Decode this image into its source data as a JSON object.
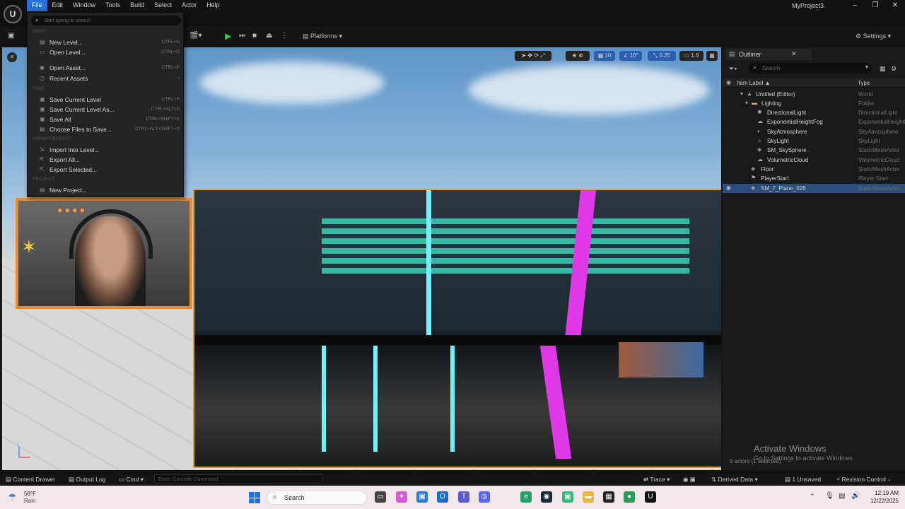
{
  "menubar": {
    "items": [
      "File",
      "Edit",
      "Window",
      "Tools",
      "Build",
      "Select",
      "Actor",
      "Help"
    ]
  },
  "window": {
    "project_name": "MyProject3"
  },
  "toolbar": {
    "platforms_label": "Platforms",
    "settings_label": "Settings"
  },
  "file_menu": {
    "search_placeholder": "Start typing to search",
    "sections": {
      "open": "OPEN",
      "save": "SAVE",
      "import_export": "IMPORT/EXPORT",
      "project": "PROJECT"
    },
    "items": [
      {
        "label": "New Level...",
        "shortcut": "CTRL+N"
      },
      {
        "label": "Open Level...",
        "shortcut": "CTRL+O"
      },
      {
        "label": "Open Asset...",
        "shortcut": "CTRL+P"
      },
      {
        "label": "Recent Assets",
        "shortcut": "›"
      },
      {
        "label": "Save Current Level",
        "shortcut": "CTRL+S"
      },
      {
        "label": "Save Current Level As...",
        "shortcut": "CTRL+ALT+S"
      },
      {
        "label": "Save All",
        "shortcut": "CTRL+SHIFT+S"
      },
      {
        "label": "Choose Files to Save...",
        "shortcut": "CTRL+ALT+SHIFT+S"
      },
      {
        "label": "Import Into Level...",
        "shortcut": ""
      },
      {
        "label": "Export All...",
        "shortcut": ""
      },
      {
        "label": "Export Selected...",
        "shortcut": ""
      },
      {
        "label": "New Project...",
        "shortcut": ""
      }
    ]
  },
  "viewport": {
    "tools": {
      "grid_snap": "10",
      "rotation_snap": "10°",
      "scale_snap": "0.25",
      "camera_speed": "1.6"
    },
    "watermark_title": "Activate Windows",
    "watermark_sub": "Go to Settings to activate Windows."
  },
  "outliner": {
    "title": "Outliner",
    "search_placeholder": "Search",
    "col_label": "Item Label ▲",
    "col_type": "Type",
    "rows": [
      {
        "name": "Untitled (Editor)",
        "type": "World"
      },
      {
        "name": "Lighting",
        "type": "Folder"
      },
      {
        "name": "DirectionalLight",
        "type": "DirectionalLight"
      },
      {
        "name": "ExponentialHeightFog",
        "type": "ExponentialHeightFog"
      },
      {
        "name": "SkyAtmosphere",
        "type": "SkyAtmosphere"
      },
      {
        "name": "SkyLight",
        "type": "SkyLight"
      },
      {
        "name": "SM_SkySphere",
        "type": "StaticMeshActor"
      },
      {
        "name": "VolumetricCloud",
        "type": "VolumetricCloud"
      },
      {
        "name": "Floor",
        "type": "StaticMeshActor"
      },
      {
        "name": "PlayerStart",
        "type": "Player Start"
      },
      {
        "name": "SM_7_Plane_028",
        "type": "StaticMeshActor"
      }
    ],
    "actor_count": "9 actors (1 selected)"
  },
  "statusbar": {
    "content_drawer": "Content Drawer",
    "output_log": "Output Log",
    "cmd": "Cmd",
    "console_placeholder": "Enter Console Command",
    "trace": "Trace",
    "derived_data": "Derived Data",
    "unsaved": "1 Unsaved",
    "revision_control": "Revision Control"
  },
  "taskbar": {
    "weather_temp": "58°F",
    "weather_cond": "Rain",
    "search_label": "Search",
    "time": "12:19 AM",
    "date": "12/22/2025"
  },
  "colors": {
    "accent": "#2a6fd6",
    "selection": "#2c4e7c",
    "mesh_outline": "#e5a323",
    "webcam_border": "#f08a2a"
  }
}
